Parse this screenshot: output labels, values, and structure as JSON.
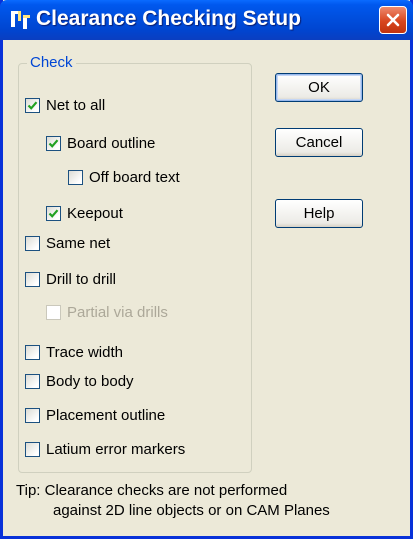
{
  "window": {
    "title": "Clearance Checking Setup"
  },
  "group": {
    "label": "Check"
  },
  "checks": [
    {
      "label": "Net to all",
      "checked": true,
      "enabled": true
    },
    {
      "label": "Board outline",
      "checked": true,
      "enabled": true
    },
    {
      "label": "Off board text",
      "checked": false,
      "enabled": true
    },
    {
      "label": "Keepout",
      "checked": true,
      "enabled": true
    },
    {
      "label": "Same net",
      "checked": false,
      "enabled": true
    },
    {
      "label": "Drill to drill",
      "checked": false,
      "enabled": true
    },
    {
      "label": "Partial via drills",
      "checked": false,
      "enabled": false
    },
    {
      "label": "Trace width",
      "checked": false,
      "enabled": true
    },
    {
      "label": "Body to body",
      "checked": false,
      "enabled": true
    },
    {
      "label": "Placement outline",
      "checked": false,
      "enabled": true
    },
    {
      "label": "Latium error markers",
      "checked": false,
      "enabled": true
    }
  ],
  "buttons": {
    "ok": "OK",
    "cancel": "Cancel",
    "help": "Help"
  },
  "tip": {
    "line1": "Tip: Clearance checks are not performed",
    "line2": "against 2D line objects or on CAM Planes"
  },
  "colors": {
    "title_bar": "#0054e3",
    "dialog_bg": "#ece9d8",
    "check_mark": "#21a121",
    "legend": "#0046d5",
    "close_button": "#d8461f"
  },
  "icons": {
    "app": "app-icon",
    "close": "close-icon",
    "check": "check-icon"
  }
}
